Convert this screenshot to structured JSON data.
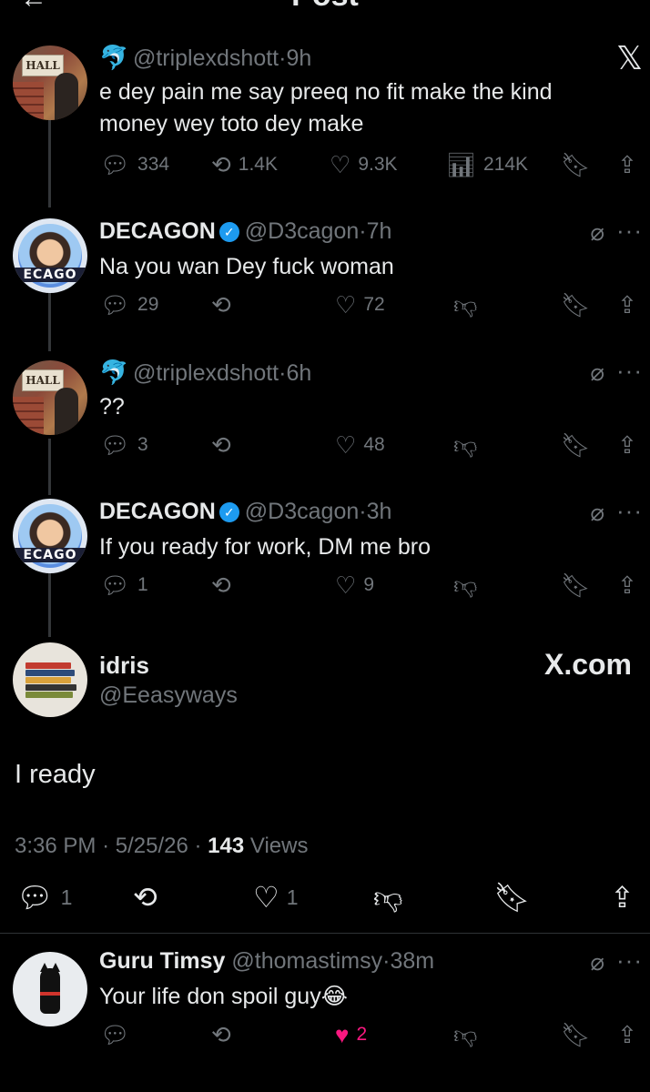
{
  "topbar": {
    "title": "Post",
    "back": "←"
  },
  "tweets": [
    {
      "name": "",
      "handle": "@triplexdshott",
      "sep": "·",
      "time": "9h",
      "text": "e dey pain me say preeq no fit make the kind money wey toto dey make",
      "replies": "334",
      "reposts": "1.4K",
      "likes": "9.3K",
      "views": "214K"
    },
    {
      "name": "DECAGON",
      "handle": "@D3cagon",
      "sep": "·",
      "time": "7h",
      "text": "Na you wan Dey fuck woman",
      "replies": "29",
      "reposts": "",
      "likes": "72"
    },
    {
      "name": "",
      "handle": "@triplexdshott",
      "sep": "·",
      "time": "6h",
      "text": "??",
      "replies": "3",
      "reposts": "",
      "likes": "48"
    },
    {
      "name": "DECAGON",
      "handle": "@D3cagon",
      "sep": "·",
      "time": "3h",
      "text": "If you ready for work, DM me bro",
      "replies": "1",
      "reposts": "",
      "likes": "9"
    }
  ],
  "focal": {
    "name": "idris",
    "handle": "@Eeasyways",
    "watermark": "X.com",
    "text": "I ready",
    "time": "3:36 PM",
    "date": "5/25/26",
    "views_count": "143",
    "views_label": "Views",
    "sep": "·",
    "replies": "1",
    "likes": "1"
  },
  "reply": {
    "name": "Guru Timsy",
    "handle": "@thomastimsy",
    "sep": "·",
    "time": "38m",
    "text": "Your life don spoil guy😂",
    "likes": "2"
  },
  "colors": {
    "bg": "#000000",
    "text": "#e7e9ea",
    "muted": "#71767b",
    "verified": "#1d9bf0",
    "like_active": "#f91880"
  },
  "icons": [
    "reply-icon",
    "repost-icon",
    "like-icon",
    "views-icon",
    "bookmark-icon",
    "share-icon",
    "grok-icon",
    "more-icon",
    "downvote-icon",
    "verified-icon",
    "x-logo-icon"
  ]
}
